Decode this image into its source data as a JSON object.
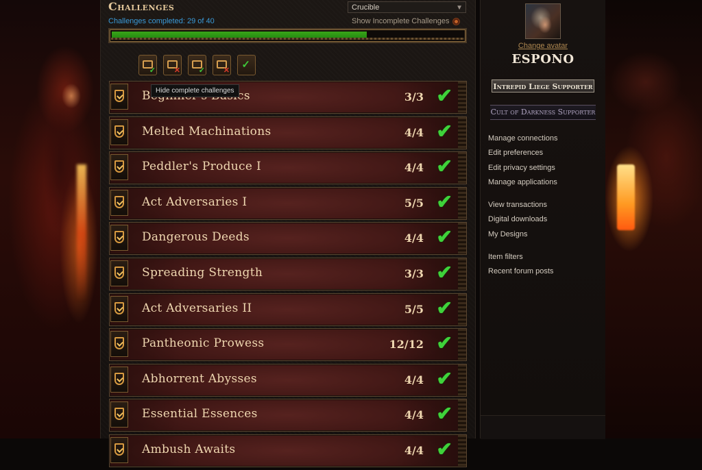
{
  "page": {
    "title": "Challenges",
    "league_select": {
      "value": "Crucible"
    },
    "completed_text": "Challenges completed: 29 of 40",
    "progress": {
      "completed": 29,
      "total": 40,
      "fraction": 0.725
    },
    "show_incomplete_label": "Show Incomplete Challenges",
    "tooltip": "Hide complete challenges",
    "colors": {
      "accent_link": "#3a9ad8",
      "progress_green": "#2a9a14",
      "row_red": "#4a1a18",
      "check_green": "#3fd23a"
    }
  },
  "filters": [
    {
      "name": "filter-complete-icon",
      "mark": "✓",
      "kind": "ok"
    },
    {
      "name": "filter-incomplete-icon",
      "mark": "✕",
      "kind": "no"
    },
    {
      "name": "filter-reward-complete-icon",
      "mark": "✓",
      "kind": "ok"
    },
    {
      "name": "filter-reward-incomplete-icon",
      "mark": "✕",
      "kind": "no"
    },
    {
      "name": "filter-all-icon",
      "mark": "✓",
      "kind": "ok"
    }
  ],
  "challenges": [
    {
      "name": "Beginner's Basics",
      "count": "3/3"
    },
    {
      "name": "Melted Machinations",
      "count": "4/4"
    },
    {
      "name": "Peddler's Produce I",
      "count": "4/4"
    },
    {
      "name": "Act Adversaries I",
      "count": "5/5"
    },
    {
      "name": "Dangerous Deeds",
      "count": "4/4"
    },
    {
      "name": "Spreading Strength",
      "count": "3/3"
    },
    {
      "name": "Act Adversaries II",
      "count": "5/5"
    },
    {
      "name": "Pantheonic Prowess",
      "count": "12/12"
    },
    {
      "name": "Abhorrent Abysses",
      "count": "4/4"
    },
    {
      "name": "Essential Essences",
      "count": "4/4"
    },
    {
      "name": "Ambush Awaits",
      "count": "4/4"
    }
  ],
  "sidebar": {
    "change_avatar": "Change avatar",
    "username": "ESPONO",
    "supporter_1": "Intrepid Liege Supporter",
    "supporter_2": "Cult of Darkness Supporter",
    "links_group_1": [
      "Manage connections",
      "Edit preferences",
      "Edit privacy settings",
      "Manage applications"
    ],
    "links_group_2": [
      "View transactions",
      "Digital downloads",
      "My Designs"
    ],
    "links_group_3": [
      "Item filters",
      "Recent forum posts"
    ]
  }
}
